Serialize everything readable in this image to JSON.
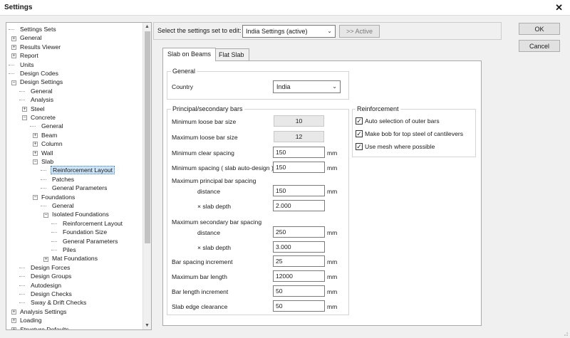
{
  "window": {
    "title": "Settings",
    "close_glyph": "✕"
  },
  "tree": {
    "items": [
      {
        "label": "Settings Sets",
        "level": 0,
        "exp": ""
      },
      {
        "label": "General",
        "level": 0,
        "exp": "+"
      },
      {
        "label": "Results Viewer",
        "level": 0,
        "exp": "+"
      },
      {
        "label": "Report",
        "level": 0,
        "exp": "+"
      },
      {
        "label": "Units",
        "level": 0,
        "exp": ""
      },
      {
        "label": "Design Codes",
        "level": 0,
        "exp": ""
      },
      {
        "label": "Design Settings",
        "level": 0,
        "exp": "-"
      },
      {
        "label": "General",
        "level": 1,
        "exp": ""
      },
      {
        "label": "Analysis",
        "level": 1,
        "exp": ""
      },
      {
        "label": "Steel",
        "level": 1,
        "exp": "+"
      },
      {
        "label": "Concrete",
        "level": 1,
        "exp": "-"
      },
      {
        "label": "General",
        "level": 2,
        "exp": ""
      },
      {
        "label": "Beam",
        "level": 2,
        "exp": "+"
      },
      {
        "label": "Column",
        "level": 2,
        "exp": "+"
      },
      {
        "label": "Wall",
        "level": 2,
        "exp": "+"
      },
      {
        "label": "Slab",
        "level": 2,
        "exp": "-"
      },
      {
        "label": "Reinforcement Layout",
        "level": 3,
        "exp": "",
        "selected": true
      },
      {
        "label": "Patches",
        "level": 3,
        "exp": ""
      },
      {
        "label": "General Parameters",
        "level": 3,
        "exp": ""
      },
      {
        "label": "Foundations",
        "level": 2,
        "exp": "-"
      },
      {
        "label": "General",
        "level": 3,
        "exp": ""
      },
      {
        "label": "Isolated Foundations",
        "level": 3,
        "exp": "-"
      },
      {
        "label": "Reinforcement Layout",
        "level": 4,
        "exp": ""
      },
      {
        "label": "Foundation Size",
        "level": 4,
        "exp": ""
      },
      {
        "label": "General Parameters",
        "level": 4,
        "exp": ""
      },
      {
        "label": "Piles",
        "level": 4,
        "exp": ""
      },
      {
        "label": "Mat Foundations",
        "level": 3,
        "exp": "+"
      },
      {
        "label": "Design Forces",
        "level": 1,
        "exp": ""
      },
      {
        "label": "Design Groups",
        "level": 1,
        "exp": ""
      },
      {
        "label": "Autodesign",
        "level": 1,
        "exp": ""
      },
      {
        "label": "Design Checks",
        "level": 1,
        "exp": ""
      },
      {
        "label": "Sway & Drift Checks",
        "level": 1,
        "exp": ""
      },
      {
        "label": "Analysis Settings",
        "level": 0,
        "exp": "+"
      },
      {
        "label": "Loading",
        "level": 0,
        "exp": "+"
      },
      {
        "label": "Structure Defaults",
        "level": 0,
        "exp": "+"
      }
    ]
  },
  "selector": {
    "label": "Select the settings set to edit:",
    "value": "India Settings (active)",
    "active_button": ">> Active"
  },
  "buttons": {
    "ok": "OK",
    "cancel": "Cancel"
  },
  "tabs": [
    {
      "label": "Slab on Beams",
      "active": true
    },
    {
      "label": "Flat Slab",
      "active": false
    }
  ],
  "general": {
    "title": "General",
    "country_label": "Country",
    "country_value": "India"
  },
  "bars": {
    "title": "Principal/secondary bars",
    "min_loose_label": "Minimum loose bar size",
    "min_loose_value": "10",
    "max_loose_label": "Maximum loose bar size",
    "max_loose_value": "12",
    "min_clear_label": "Minimum clear spacing",
    "min_clear_value": "150",
    "min_spacing_label": "Minimum spacing ( slab auto-design )",
    "min_spacing_value": "150",
    "max_principal_label": "Maximum principal bar spacing",
    "distance_label": "distance",
    "max_principal_distance": "150",
    "xslab_label": "× slab depth",
    "max_principal_xslab": "2.000",
    "max_secondary_label": "Maximum secondary bar spacing",
    "max_secondary_distance": "250",
    "max_secondary_xslab": "3.000",
    "spacing_inc_label": "Bar spacing increment",
    "spacing_inc_value": "25",
    "max_length_label": "Maximum bar length",
    "max_length_value": "12000",
    "length_inc_label": "Bar length increment",
    "length_inc_value": "50",
    "edge_clear_label": "Slab edge clearance",
    "edge_clear_value": "50",
    "unit_mm": "mm"
  },
  "reinforcement": {
    "title": "Reinforcement",
    "options": [
      {
        "label": "Auto selection of outer bars",
        "checked": true
      },
      {
        "label": "Make bob for top steel of cantilevers",
        "checked": true
      },
      {
        "label": "Use mesh where possible",
        "checked": true
      }
    ]
  }
}
